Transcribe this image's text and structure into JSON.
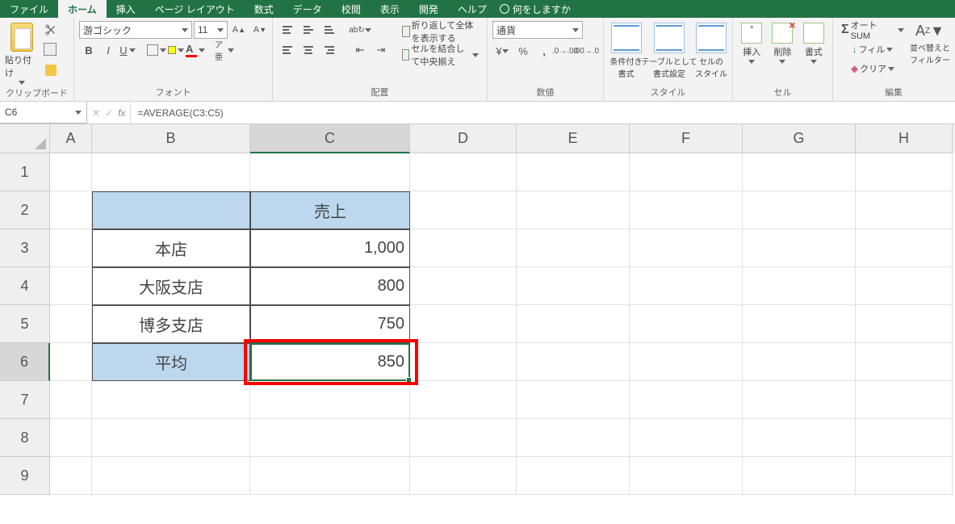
{
  "tabs": {
    "file": "ファイル",
    "home": "ホーム",
    "insert": "挿入",
    "pagelayout": "ページ レイアウト",
    "formulas": "数式",
    "data": "データ",
    "review": "校閲",
    "view": "表示",
    "developer": "開発",
    "help": "ヘルプ",
    "tellme": "何をしますか"
  },
  "ribbon": {
    "clipboard": {
      "paste": "貼り付け",
      "label": "クリップボード"
    },
    "font": {
      "name": "游ゴシック",
      "size": "11",
      "label": "フォント"
    },
    "alignment": {
      "wrap": "折り返して全体を表示する",
      "merge": "セルを結合して中央揃え",
      "label": "配置"
    },
    "number": {
      "format": "通貨",
      "label": "数値"
    },
    "styles": {
      "cond": "条件付き\n書式",
      "table": "テーブルとして\n書式設定",
      "cell": "セルの\nスタイル",
      "label": "スタイル"
    },
    "cells": {
      "insert": "挿入",
      "delete": "削除",
      "format": "書式",
      "label": "セル"
    },
    "editing": {
      "sum": "オート SUM",
      "fill": "フィル",
      "clear": "クリア",
      "sort": "並べ替えと\nフィルター",
      "label": "編集"
    }
  },
  "formula_bar": {
    "name_box": "C6",
    "formula": "=AVERAGE(C3:C5)"
  },
  "columns": [
    "A",
    "B",
    "C",
    "D",
    "E",
    "F",
    "G",
    "H"
  ],
  "rows": [
    "1",
    "2",
    "3",
    "4",
    "5",
    "6",
    "7",
    "8",
    "9"
  ],
  "cells": {
    "C2": "売上",
    "B3": "本店",
    "C3": "1,000",
    "B4": "大阪支店",
    "C4": "800",
    "B5": "博多支店",
    "C5": "750",
    "B6": "平均",
    "C6": "850"
  },
  "selected_cell": "C6"
}
